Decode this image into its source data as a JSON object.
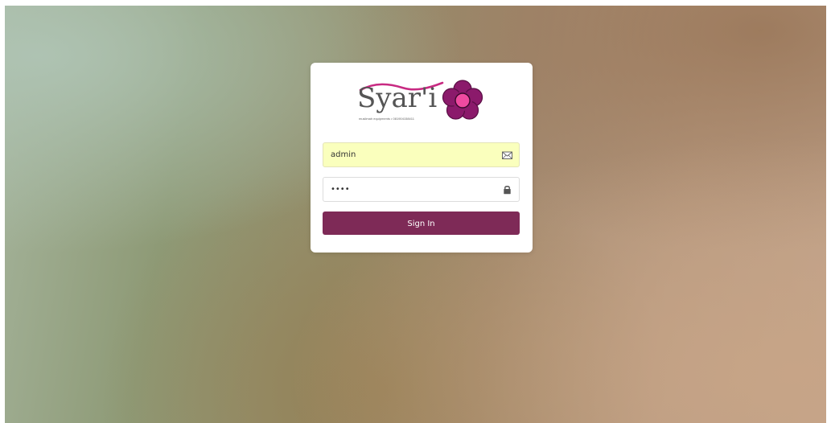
{
  "login": {
    "brand": {
      "name": "Syar'i",
      "tagline": "muslimah equipments • 081904158411"
    },
    "email": {
      "value": "admin",
      "icon": "envelope-icon"
    },
    "password": {
      "value": "••••",
      "icon": "lock-icon"
    },
    "submit_label": "Sign In"
  },
  "colors": {
    "button": "#7e2a57",
    "autofill": "#faffbd",
    "flower_outer": "#8b1a6b",
    "flower_center": "#ee4aa0",
    "wave": "#c82a82"
  }
}
